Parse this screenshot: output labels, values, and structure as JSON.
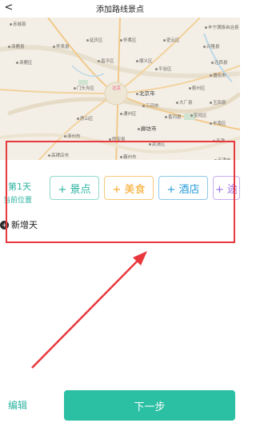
{
  "header": {
    "back_glyph": "<",
    "title": "添加路线景点"
  },
  "map": {
    "capital": "北京",
    "cities": [
      {
        "name": "赤城县"
      },
      {
        "name": "丰宁满族自治县"
      },
      {
        "name": "涿鹿县"
      },
      {
        "name": "怀来县"
      },
      {
        "name": "延庆区"
      },
      {
        "name": "怀柔区"
      },
      {
        "name": "密云区"
      },
      {
        "name": "兴隆县"
      },
      {
        "name": "涿鹿区"
      },
      {
        "name": "顺义区"
      },
      {
        "name": "昌平区"
      },
      {
        "name": "平谷区"
      },
      {
        "name": "门头沟区"
      },
      {
        "name": "三河市"
      },
      {
        "name": "北京市"
      },
      {
        "name": "房山区"
      },
      {
        "name": "通州区"
      },
      {
        "name": "固安县"
      },
      {
        "name": "廊坊市"
      },
      {
        "name": "涿州市"
      },
      {
        "name": "高碑店市"
      },
      {
        "name": "霸州市"
      },
      {
        "name": "武清区"
      },
      {
        "name": "天津"
      },
      {
        "name": "蓟州区"
      },
      {
        "name": "玉田县"
      },
      {
        "name": "遵化市"
      },
      {
        "name": "迁西县"
      },
      {
        "name": "宝坻区"
      },
      {
        "name": "丰南区"
      },
      {
        "name": "香河县"
      },
      {
        "name": "大厂县"
      },
      {
        "name": "天津市"
      }
    ]
  },
  "panel": {
    "day_title": "第1天",
    "day_sub": "当前位置",
    "chips": [
      {
        "label": "+ 景点",
        "color": "#2bb3a0"
      },
      {
        "label": "+ 美食",
        "color": "#f5a623"
      },
      {
        "label": "+ 酒店",
        "color": "#2a9dd9"
      },
      {
        "label": "+ 途",
        "color": "#9b6de0"
      }
    ],
    "add_day_icon": "+",
    "add_day_label": "新增天"
  },
  "footer": {
    "edit_label": "编辑",
    "next_label": "下一步"
  }
}
